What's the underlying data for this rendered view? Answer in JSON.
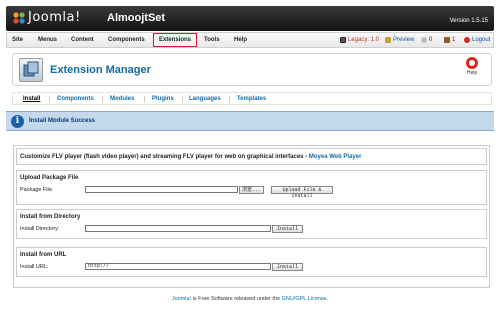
{
  "header": {
    "logo_text": "Joomla!",
    "site_name": "AlmoojtSet",
    "version": "Version 1.5.15"
  },
  "menu": {
    "items": [
      "Site",
      "Menus",
      "Content",
      "Components",
      "Extensions",
      "Tools",
      "Help"
    ],
    "active": "Extensions"
  },
  "status": {
    "legacy": "Legacy: 1.0",
    "preview": "Preview",
    "messages_count": "0",
    "users_count": "1",
    "logout": "Logout"
  },
  "toolbar": {
    "title": "Extension Manager",
    "help_label": "Help"
  },
  "subnav": {
    "items": [
      "Install",
      "Components",
      "Modules",
      "Plugins",
      "Languages",
      "Templates"
    ],
    "current": "Install"
  },
  "message": {
    "text": "Install Module Success"
  },
  "install": {
    "description": "Customize FLV player (flash video player) and streaming FLV player for web on graphical interfaces - ",
    "description_link": "Moyea Web Player",
    "package": {
      "title": "Upload Package File",
      "label": "Package File:",
      "browse_label": "浏览...",
      "button_label": "Upload File & Install",
      "value": ""
    },
    "directory": {
      "title": "Install from Directory",
      "label": "Install Directory:",
      "button_label": "Install",
      "value": ""
    },
    "url": {
      "title": "Install from URL",
      "label": "Install URL:",
      "button_label": "Install",
      "value": "http://"
    }
  },
  "footer": {
    "link1": "Joomla!",
    "text": " is Free Software released under the ",
    "link2": "GNU/GPL License",
    "end": "."
  },
  "colors": {
    "accent": "#146aa4",
    "active_border": "#d01f2a",
    "message_bg": "#c3d9ec"
  }
}
